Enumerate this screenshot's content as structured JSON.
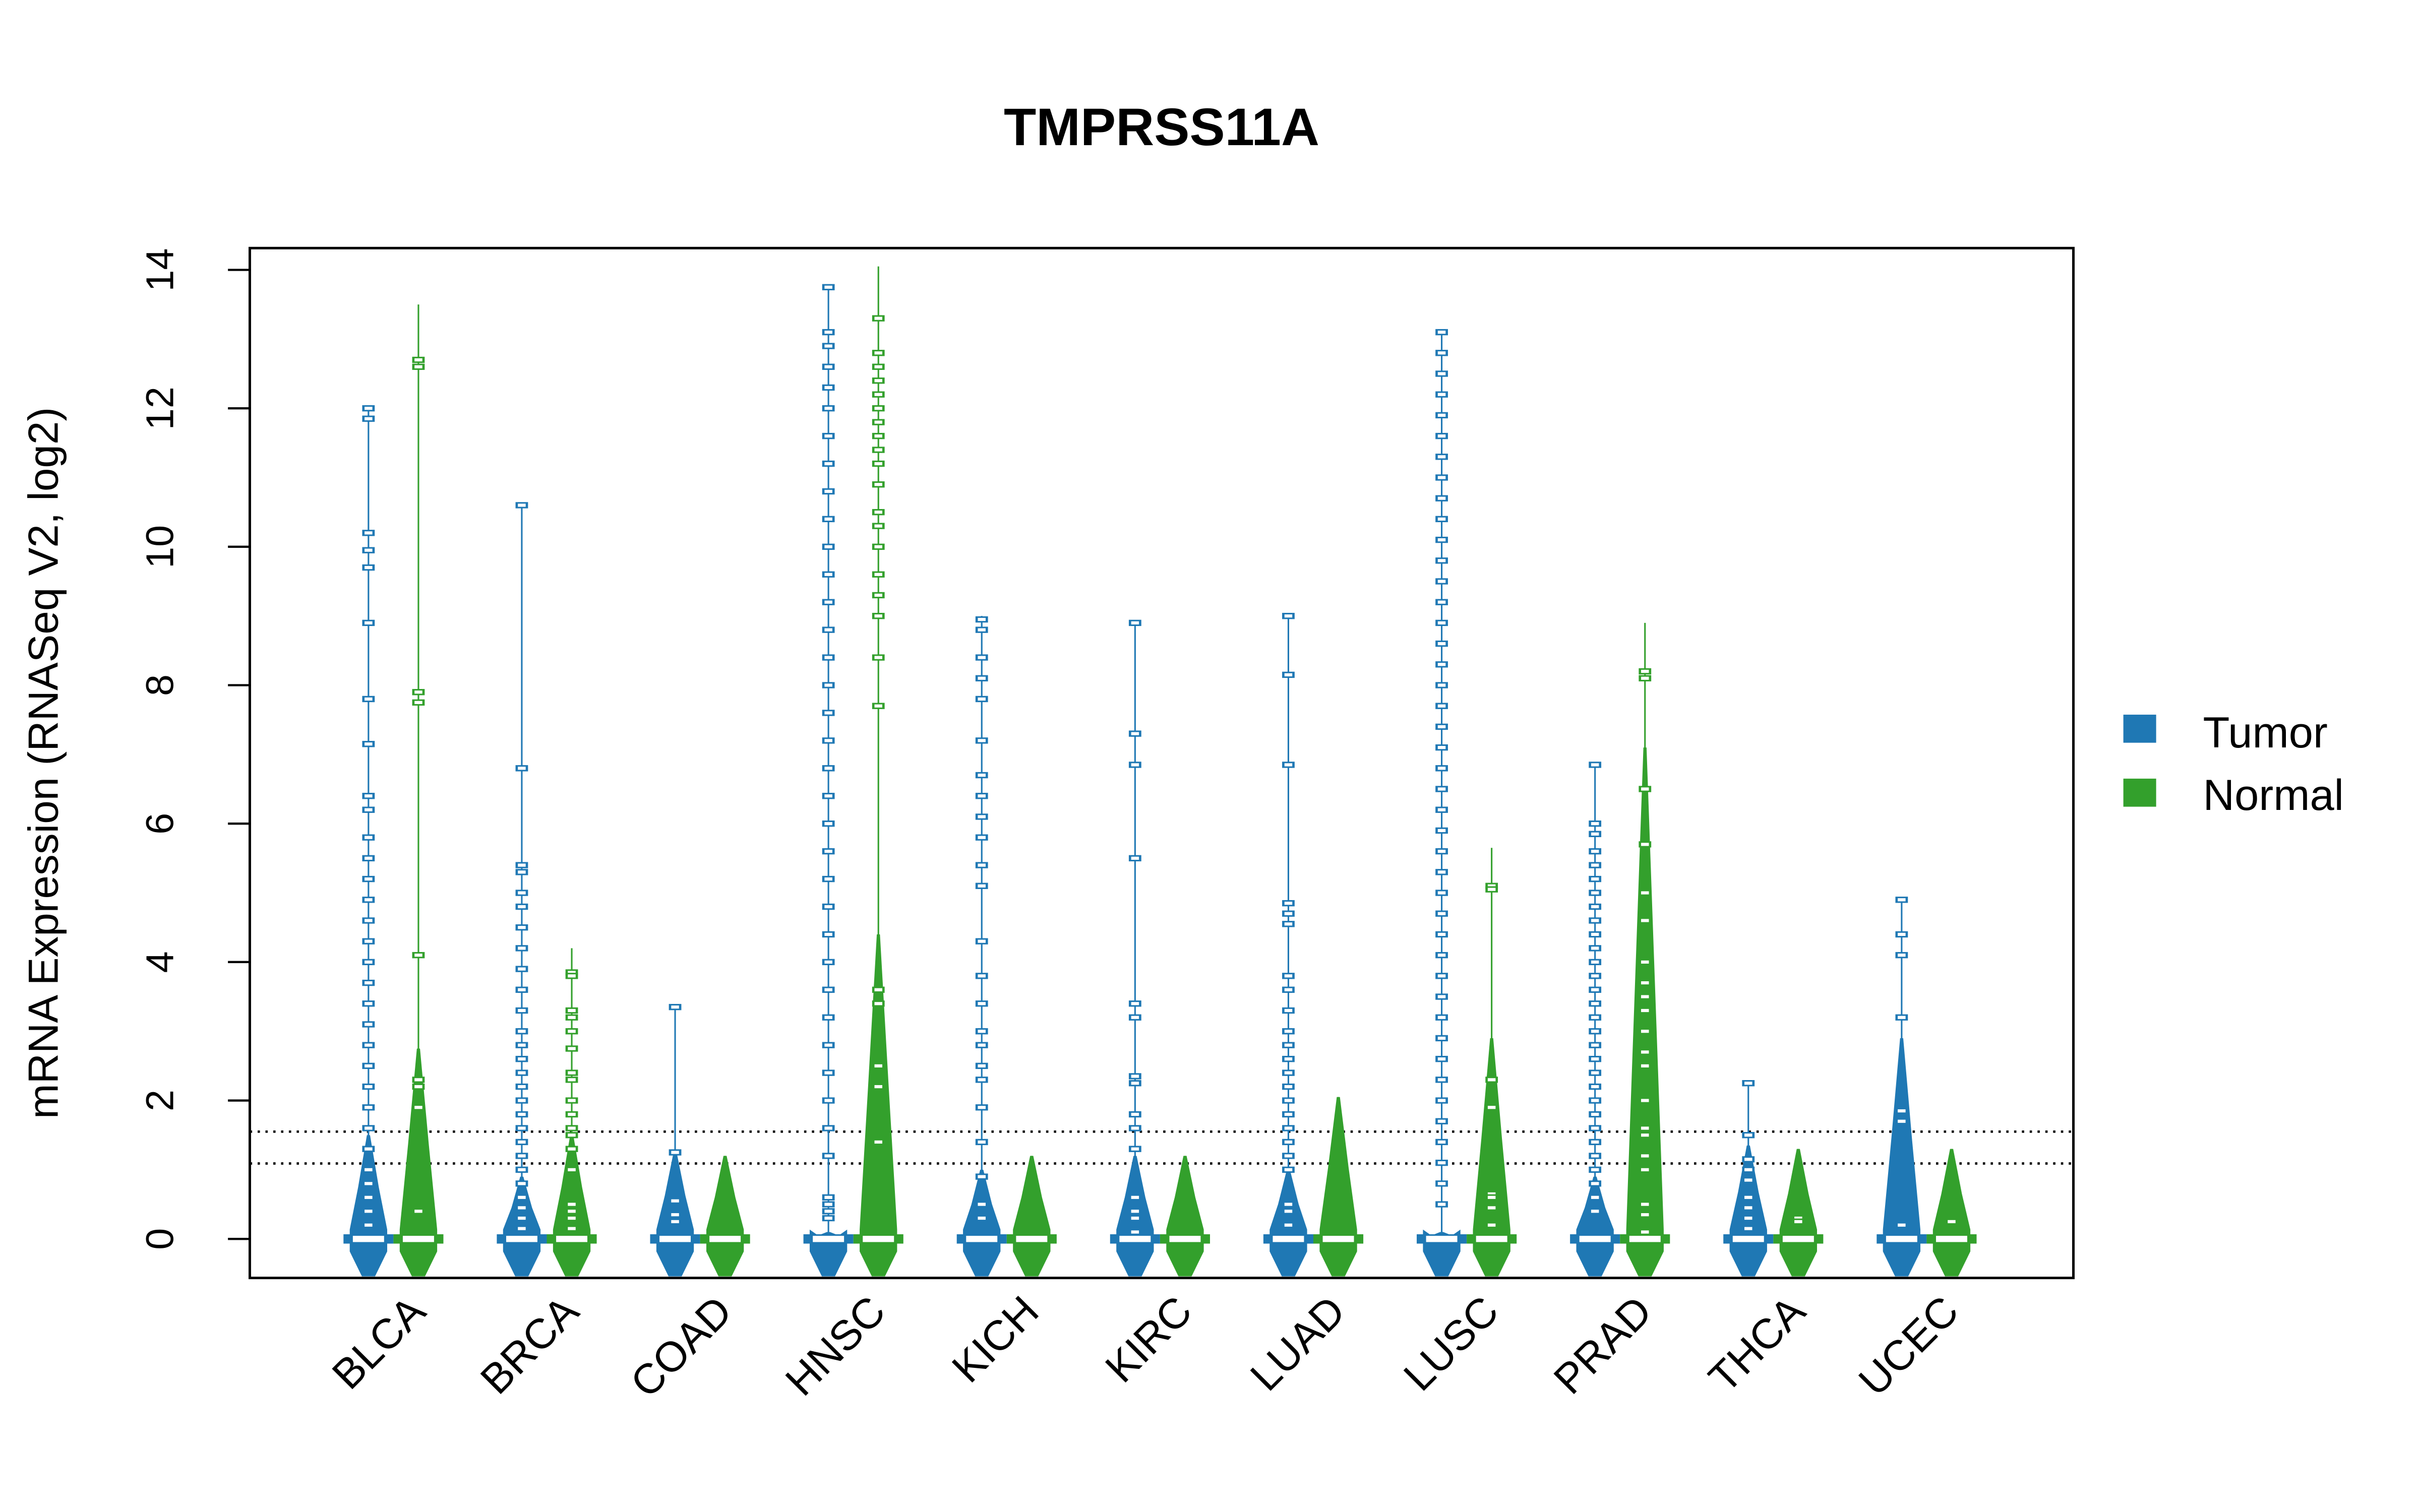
{
  "chart_data": {
    "type": "violin",
    "subtype": "beanplot",
    "title": "TMPRSS11A",
    "xlabel": "",
    "ylabel": "mRNA Expression (RNASeq V2, log2)",
    "ylim": [
      -0.55,
      14.3
    ],
    "yticks": [
      0,
      2,
      4,
      6,
      8,
      10,
      12,
      14
    ],
    "ytick_labels": [
      "0",
      "2",
      "4",
      "6",
      "8",
      "10",
      "12",
      "14"
    ],
    "grid": false,
    "legend_position": "right",
    "reference_lines": [
      {
        "y": 1.55,
        "style": "dotted"
      },
      {
        "y": 1.09,
        "style": "dotted"
      }
    ],
    "categories": [
      "BLCA",
      "BRCA",
      "COAD",
      "HNSC",
      "KICH",
      "KIRC",
      "LUAD",
      "LUSC",
      "PRAD",
      "THCA",
      "UCEC"
    ],
    "series": [
      {
        "name": "Tumor",
        "color": "#1f78b4",
        "groups": [
          {
            "min": 0,
            "max": 12.0,
            "mean_line": 0.0,
            "body_top": 1.5,
            "points": [
              12.0,
              11.85,
              10.2,
              9.95,
              9.7,
              8.9,
              7.8,
              7.15,
              6.4,
              6.2,
              5.8,
              5.5,
              5.2,
              4.9,
              4.6,
              4.3,
              4.0,
              3.7,
              3.4,
              3.1,
              2.8,
              2.5,
              2.2,
              1.9,
              1.6,
              1.3,
              1.0,
              0.8,
              0.6,
              0.4,
              0.2
            ]
          },
          {
            "min": 0,
            "max": 10.6,
            "mean_line": 0.0,
            "body_top": 0.9,
            "points": [
              10.6,
              6.8,
              5.4,
              5.3,
              5.0,
              4.8,
              4.5,
              4.2,
              3.9,
              3.6,
              3.3,
              3.0,
              2.8,
              2.6,
              2.4,
              2.2,
              2.0,
              1.8,
              1.6,
              1.4,
              1.2,
              1.0,
              0.8,
              0.6,
              0.45,
              0.3,
              0.15
            ]
          },
          {
            "min": 0,
            "max": 3.35,
            "mean_line": 0.0,
            "body_top": 1.25,
            "points": [
              3.35,
              1.25,
              0.55,
              0.35,
              0.25
            ]
          },
          {
            "min": 0,
            "max": 13.75,
            "mean_line": 0.0,
            "body_top": 0.1,
            "points": [
              13.75,
              13.1,
              12.9,
              12.6,
              12.3,
              12.0,
              11.6,
              11.2,
              10.8,
              10.4,
              10.0,
              9.6,
              9.2,
              8.8,
              8.4,
              8.0,
              7.6,
              7.2,
              6.8,
              6.4,
              6.0,
              5.6,
              5.2,
              4.8,
              4.4,
              4.0,
              3.6,
              3.2,
              2.8,
              2.4,
              2.0,
              1.6,
              1.2,
              0.6,
              0.5,
              0.4,
              0.3
            ]
          },
          {
            "min": 0,
            "max": 9.0,
            "mean_line": 0.0,
            "body_top": 1.0,
            "points": [
              8.95,
              8.8,
              8.4,
              8.1,
              7.8,
              7.2,
              6.7,
              6.4,
              6.1,
              5.8,
              5.4,
              5.1,
              4.3,
              3.8,
              3.4,
              3.0,
              2.8,
              2.5,
              2.3,
              1.9,
              1.4,
              0.9,
              0.5,
              0.3
            ]
          },
          {
            "min": 0,
            "max": 8.9,
            "mean_line": 0.0,
            "body_top": 1.2,
            "points": [
              8.9,
              7.3,
              6.85,
              5.5,
              3.4,
              3.2,
              2.35,
              2.25,
              1.8,
              1.6,
              1.3,
              0.6,
              0.4,
              0.3,
              0.1
            ]
          },
          {
            "min": 0,
            "max": 9.0,
            "mean_line": 0.0,
            "body_top": 1.0,
            "points": [
              9.0,
              8.15,
              6.85,
              4.85,
              4.7,
              4.55,
              3.8,
              3.6,
              3.3,
              3.0,
              2.8,
              2.6,
              2.4,
              2.2,
              2.0,
              1.8,
              1.6,
              1.4,
              1.2,
              1.0,
              0.5,
              0.4,
              0.2
            ]
          },
          {
            "min": 0,
            "max": 13.1,
            "mean_line": 0.0,
            "body_top": 0.1,
            "points": [
              13.1,
              12.8,
              12.5,
              12.2,
              11.9,
              11.6,
              11.3,
              11.0,
              10.7,
              10.4,
              10.1,
              9.8,
              9.5,
              9.2,
              8.9,
              8.6,
              8.3,
              8.0,
              7.7,
              7.4,
              7.1,
              6.8,
              6.5,
              6.2,
              5.9,
              5.6,
              5.3,
              5.0,
              4.7,
              4.4,
              4.1,
              3.8,
              3.5,
              3.2,
              2.9,
              2.6,
              2.3,
              2.0,
              1.7,
              1.4,
              1.1,
              0.8,
              0.5
            ]
          },
          {
            "min": 0,
            "max": 6.85,
            "mean_line": 0.0,
            "body_top": 0.9,
            "points": [
              6.85,
              6.0,
              5.85,
              5.6,
              5.4,
              5.2,
              5.0,
              4.8,
              4.6,
              4.4,
              4.2,
              4.0,
              3.8,
              3.6,
              3.4,
              3.2,
              3.0,
              2.8,
              2.6,
              2.4,
              2.2,
              2.0,
              1.8,
              1.6,
              1.4,
              1.2,
              1.0,
              0.8,
              0.6,
              0.4
            ]
          },
          {
            "min": 0,
            "max": 2.25,
            "mean_line": 0.0,
            "body_top": 1.35,
            "points": [
              2.25,
              1.5,
              1.15,
              1.0,
              0.85,
              0.6,
              0.45,
              0.3,
              0.15
            ]
          },
          {
            "min": 0,
            "max": 4.9,
            "mean_line": 0.0,
            "body_top": 2.9,
            "points": [
              4.9,
              4.4,
              4.1,
              3.2,
              1.85,
              1.7,
              0.2
            ]
          }
        ]
      },
      {
        "name": "Normal",
        "color": "#33a02c",
        "groups": [
          {
            "min": 0,
            "max": 13.5,
            "mean_line": 0.0,
            "body_top": 2.75,
            "points": [
              12.7,
              12.6,
              7.9,
              7.75,
              4.1,
              2.3,
              2.2,
              1.9,
              0.4
            ]
          },
          {
            "min": 0,
            "max": 4.2,
            "mean_line": 0.0,
            "body_top": 1.5,
            "points": [
              3.85,
              3.8,
              3.3,
              3.2,
              3.0,
              2.75,
              2.4,
              2.3,
              2.0,
              1.8,
              1.6,
              1.5,
              1.3,
              1.0,
              0.5,
              0.4,
              0.3,
              0.15
            ]
          },
          {
            "min": 0,
            "max": 1.2,
            "mean_line": 0.0,
            "body_top": 1.2,
            "points": []
          },
          {
            "min": 0,
            "max": 14.05,
            "mean_line": 0.0,
            "body_top": 4.4,
            "points": [
              13.3,
              12.8,
              12.6,
              12.4,
              12.2,
              12.0,
              11.8,
              11.6,
              11.4,
              11.2,
              10.9,
              10.5,
              10.3,
              10.0,
              9.6,
              9.3,
              9.0,
              8.4,
              7.7,
              3.6,
              3.4,
              2.5,
              2.2,
              1.4,
              0.0
            ]
          },
          {
            "min": 0,
            "max": 1.2,
            "mean_line": 0.0,
            "body_top": 1.2,
            "points": []
          },
          {
            "min": 0,
            "max": 1.2,
            "mean_line": 0.0,
            "body_top": 1.2,
            "points": []
          },
          {
            "min": 0,
            "max": 2.05,
            "mean_line": 0.0,
            "body_top": 2.05,
            "points": []
          },
          {
            "min": 0,
            "max": 5.65,
            "mean_line": 0.0,
            "body_top": 2.9,
            "points": [
              5.1,
              5.05,
              2.3,
              1.9,
              0.65,
              0.6,
              0.45,
              0.2
            ]
          },
          {
            "min": 0,
            "max": 8.9,
            "mean_line": 0.0,
            "body_top": 7.1,
            "points": [
              8.2,
              8.1,
              6.5,
              5.7,
              5.0,
              4.6,
              4.0,
              3.7,
              3.5,
              3.3,
              3.0,
              2.7,
              2.5,
              2.0,
              1.6,
              1.5,
              1.2,
              1.0,
              0.5,
              0.35,
              0.1
            ]
          },
          {
            "min": 0,
            "max": 1.3,
            "mean_line": 0.0,
            "body_top": 1.3,
            "points": [
              0.3,
              0.25
            ]
          },
          {
            "min": 0,
            "max": 1.3,
            "mean_line": 0.0,
            "body_top": 1.3,
            "points": [
              0.25
            ]
          }
        ]
      }
    ]
  }
}
